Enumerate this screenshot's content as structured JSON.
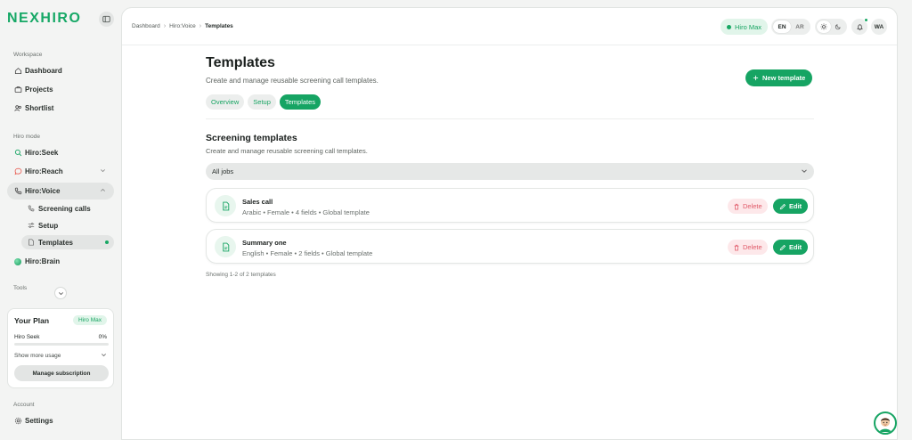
{
  "brand": {
    "logo": "NEXHIRO",
    "accent": "#16a463"
  },
  "sidebar": {
    "workspace_label": "Workspace",
    "workspace_items": [
      {
        "label": "Dashboard",
        "icon": "home-icon"
      },
      {
        "label": "Projects",
        "icon": "briefcase-icon"
      },
      {
        "label": "Shortlist",
        "icon": "users-icon"
      }
    ],
    "mode_label": "Hiro mode",
    "mode_items": [
      {
        "label": "Hiro:Seek",
        "icon": "search-icon"
      },
      {
        "label": "Hiro:Reach",
        "icon": "chat-icon"
      },
      {
        "label": "Hiro:Voice",
        "icon": "phone-icon"
      }
    ],
    "voice_sub": [
      {
        "label": "Screening calls",
        "icon": "phone-icon"
      },
      {
        "label": "Setup",
        "icon": "sliders-icon"
      },
      {
        "label": "Templates",
        "icon": "file-icon"
      }
    ],
    "brain_label": "Hiro:Brain",
    "tools_label": "Tools",
    "plan": {
      "title": "Your Plan",
      "badge": "Hiro Max",
      "usage_label": "Hiro Seek",
      "usage_value": "0%",
      "usage_fraction": 0,
      "show_more": "Show more usage",
      "manage": "Manage subscription"
    },
    "account_label": "Account",
    "settings_label": "Settings"
  },
  "topbar": {
    "breadcrumb": [
      "Dashboard",
      "Hiro:Voice",
      "Templates"
    ],
    "plan_pill": "Hiro Max",
    "lang": [
      "EN",
      "AR"
    ],
    "lang_active": "EN",
    "avatar": "WA"
  },
  "page": {
    "title": "Templates",
    "subtitle": "Create and manage reusable screening call templates.",
    "new_button": "New template",
    "tabs": [
      "Overview",
      "Setup",
      "Templates"
    ],
    "active_tab": "Templates"
  },
  "templates_section": {
    "title": "Screening templates",
    "subtitle": "Create and manage reusable screening call templates.",
    "filter": "All jobs",
    "items": [
      {
        "name": "Sales call",
        "meta": "Arabic • Female • 4 fields • Global template"
      },
      {
        "name": "Summary one",
        "meta": "English • Female • 2 fields • Global template"
      }
    ],
    "delete_label": "Delete",
    "edit_label": "Edit",
    "showing": "Showing 1-2 of 2 templates"
  }
}
